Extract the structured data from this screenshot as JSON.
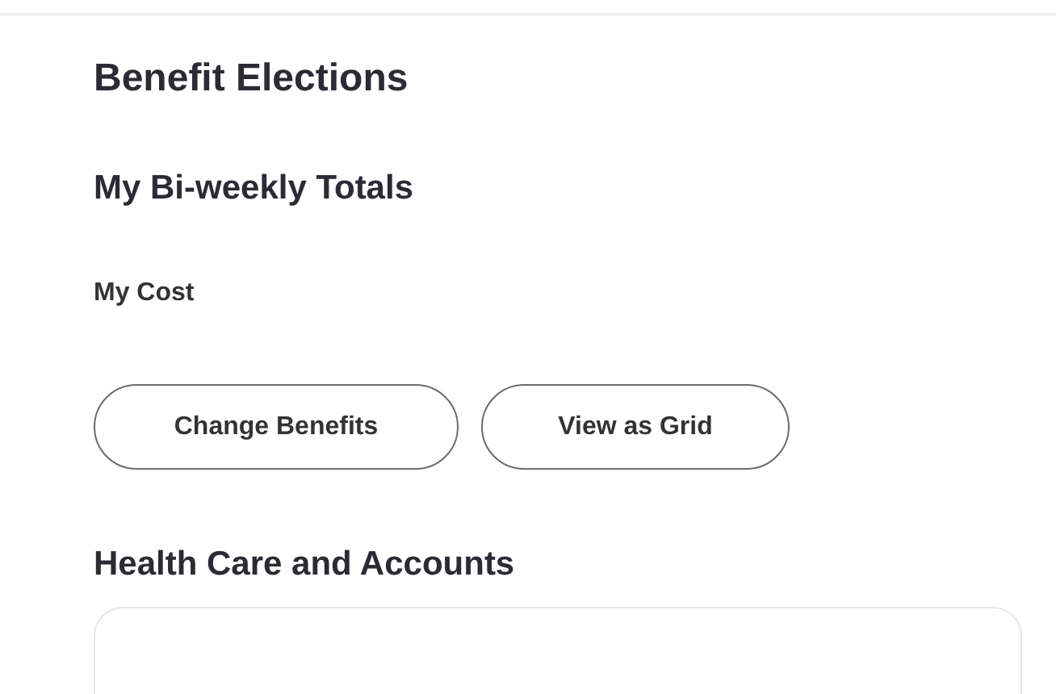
{
  "page": {
    "title": "Benefit Elections"
  },
  "totals": {
    "heading": "My Bi-weekly Totals",
    "label": "My Cost"
  },
  "buttons": [
    "Change Benefits",
    "View as Grid"
  ],
  "section": {
    "heading": "Health Care and Accounts"
  }
}
